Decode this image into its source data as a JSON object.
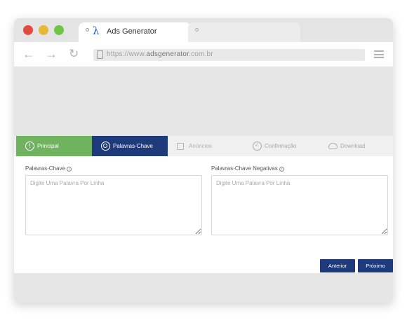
{
  "browser": {
    "tab_title": "Ads Generator",
    "tab_logo": "λ",
    "url_prefix": "https://www.",
    "url_domain": "adsgenerator",
    "url_suffix": ".com.br"
  },
  "steps": [
    {
      "label": "Principal",
      "state": "done",
      "icon": "info-icon"
    },
    {
      "label": "Palavras-Chave",
      "state": "active",
      "icon": "search-icon"
    },
    {
      "label": "Anúncios",
      "state": "pending",
      "icon": "document-icon"
    },
    {
      "label": "Confirmação",
      "state": "pending",
      "icon": "check-circle-icon"
    },
    {
      "label": "Download",
      "state": "pending",
      "icon": "cloud-download-icon"
    }
  ],
  "form": {
    "keywords_label": "Palavras-Chave",
    "keywords_placeholder": "Digite Uma Palavra Por Linha",
    "negative_label": "Palavras-Chave Negativas",
    "negative_placeholder": "Digite Uma Palavra Por Linha"
  },
  "buttons": {
    "prev": "Anterior",
    "next": "Próximo"
  },
  "colors": {
    "done": "#6fb35e",
    "active": "#1f3a7a",
    "button": "#1f3a7a"
  }
}
